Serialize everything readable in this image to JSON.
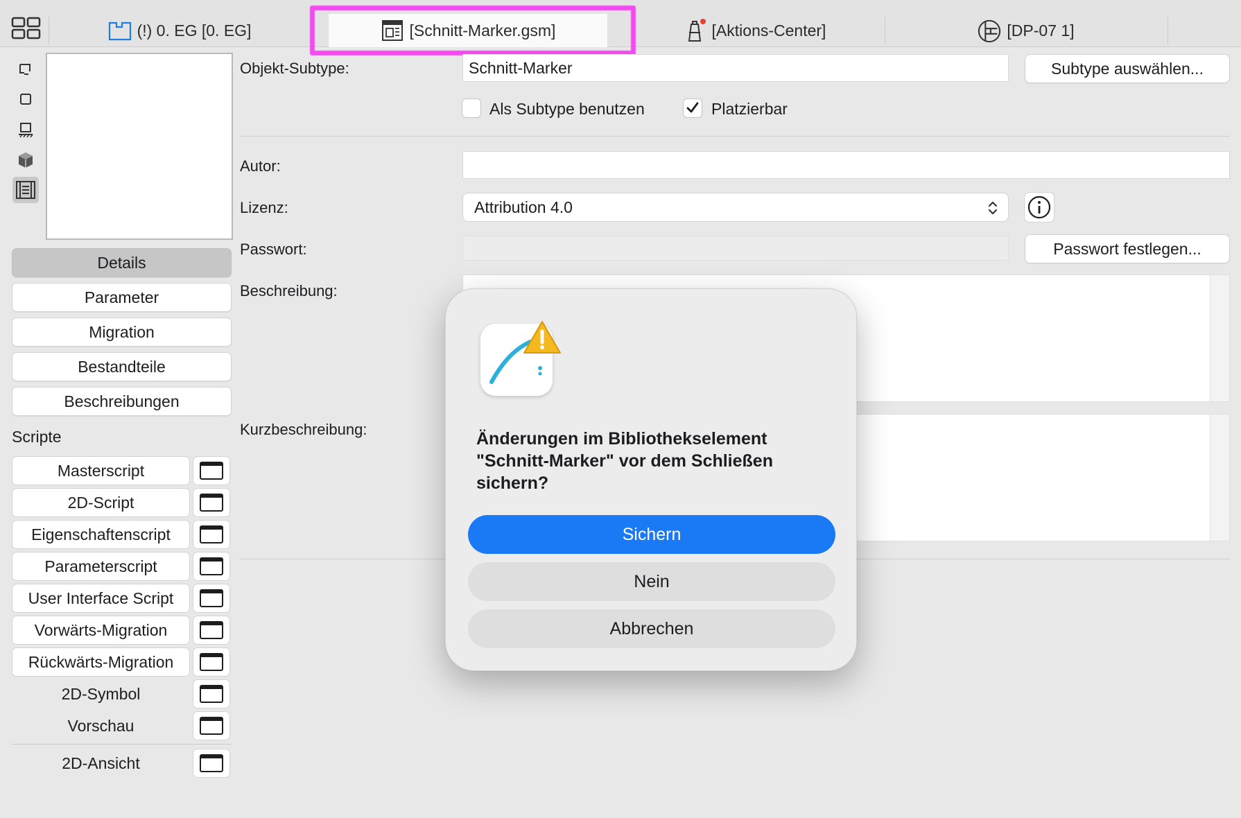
{
  "tabs": [
    {
      "label": "(!) 0. EG [0. EG]",
      "icon": "floor-plan-icon"
    },
    {
      "label": "[Schnitt-Marker.gsm]",
      "icon": "library-object-icon"
    },
    {
      "label": "[Aktions-Center]",
      "icon": "lighthouse-icon"
    },
    {
      "label": "[DP-07 1]",
      "icon": "detail-icon"
    }
  ],
  "nav": {
    "details": "Details",
    "parameter": "Parameter",
    "migration": "Migration",
    "bestandteile": "Bestandteile",
    "beschreibungen": "Beschreibungen"
  },
  "scripts_label": "Scripte",
  "scripts": [
    "Masterscript",
    "2D-Script",
    "Eigenschaftenscript",
    "Parameterscript",
    "User Interface Script",
    "Vorwärts-Migration",
    "Rückwärts-Migration",
    "2D-Symbol",
    "Vorschau",
    "2D-Ansicht"
  ],
  "form": {
    "subtype_label": "Objekt-Subtype:",
    "subtype_value": "Schnitt-Marker",
    "subtype_button": "Subtype auswählen...",
    "use_as_subtype": "Als Subtype benutzen",
    "placeable": "Platzierbar",
    "placeable_checked": true,
    "use_as_subtype_checked": false,
    "author_label": "Autor:",
    "author_value": "",
    "license_label": "Lizenz:",
    "license_value": "Attribution 4.0",
    "password_label": "Passwort:",
    "password_button": "Passwort festlegen...",
    "description_label": "Beschreibung:",
    "short_description_label": "Kurzbeschreibung:"
  },
  "dialog": {
    "message": "Änderungen im Bibliothekselement \"Schnitt-Marker\" vor dem Schließen sichern?",
    "save": "Sichern",
    "no": "Nein",
    "cancel": "Abbrechen",
    "accent_color": "#1a7af5"
  }
}
